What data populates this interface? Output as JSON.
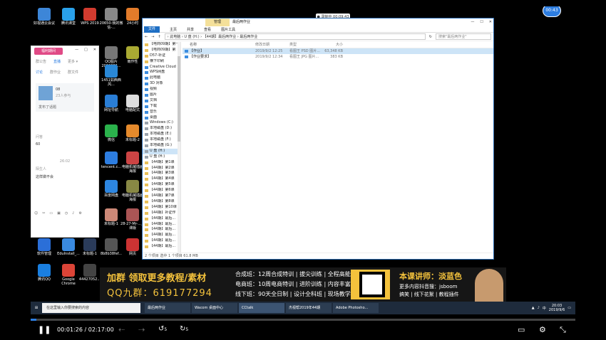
{
  "recording_badge": "● 录制中 00:09:43",
  "timer_badge": "00:43",
  "desktop_icons": [
    {
      "label": "好视通云会议",
      "color": "#3d86d8"
    },
    {
      "label": "腾讯课堂",
      "color": "#2aa1ea"
    },
    {
      "label": "WPS 2019",
      "color": "#d23b2f"
    },
    {
      "label": "20650-我的微信-...",
      "color": "#888"
    },
    {
      "label": "24小时",
      "color": "#e27b2a"
    },
    {
      "label": "QQ图片2019062...",
      "color": "#777"
    },
    {
      "label": "雨作性",
      "color": "#aa3"
    },
    {
      "label": "1451如西西风...",
      "color": "#2a88d6"
    },
    {
      "label": "网址导航",
      "color": "#2a7ed6"
    },
    {
      "label": "电脑配式",
      "color": "#ddd"
    },
    {
      "label": "微信",
      "color": "#2bb24c"
    },
    {
      "label": "未标题-2",
      "color": "#e58a2c"
    },
    {
      "label": "tencent.c...",
      "color": "#2d7de0"
    },
    {
      "label": "电脑机械插画海报",
      "color": "#c44"
    },
    {
      "label": "百度网盘",
      "color": "#2d86e0"
    },
    {
      "label": "电脑机械插画海报",
      "color": "#884"
    },
    {
      "label": "未标题-1",
      "color": "#c87"
    },
    {
      "label": "28-27-Mr-...上课版",
      "color": "#a55"
    },
    {
      "label": "软件管理",
      "color": "#2b6fd8"
    },
    {
      "label": "EduInstall_...",
      "color": "#3a8ae0"
    },
    {
      "label": "未标题-1",
      "color": "#2a3b5a"
    },
    {
      "label": "8b8b38fef...",
      "color": "#555"
    },
    {
      "label": "网页",
      "color": "#c33"
    },
    {
      "label": "腾讯QQ",
      "color": "#1a7fe0"
    },
    {
      "label": "Google Chrome",
      "color": "#db4437"
    },
    {
      "label": "44427052...",
      "color": "#444"
    }
  ],
  "explorer": {
    "context_tab": "管理",
    "title": "最后两作业",
    "window_controls": [
      "—",
      "☐",
      "✕"
    ],
    "ribbon_tabs": [
      "文件",
      "主页",
      "共享",
      "查看",
      "图片工具"
    ],
    "address": "› 此电脑 › U 盘 (H:) › 【44期】最后两作业 › 最后两作业",
    "search_placeholder": "搜索\"最后两作业\"",
    "nav_items": [
      {
        "label": "【电商09期】第一",
        "kind": "folder"
      },
      {
        "label": "【电商09期】第",
        "kind": "folder"
      },
      {
        "label": "D57-补证",
        "kind": "folder"
      },
      {
        "label": "横下印刷",
        "kind": "folder"
      },
      {
        "label": "Creative Cloud",
        "kind": "blue"
      },
      {
        "label": "WPS网盘",
        "kind": "blue"
      },
      {
        "label": "此电脑",
        "kind": "blue"
      },
      {
        "label": "3D 对象",
        "kind": "blue"
      },
      {
        "label": "视频",
        "kind": "blue"
      },
      {
        "label": "图片",
        "kind": "blue"
      },
      {
        "label": "文档",
        "kind": "blue"
      },
      {
        "label": "下载",
        "kind": "blue"
      },
      {
        "label": "音乐",
        "kind": "blue"
      },
      {
        "label": "桌面",
        "kind": "blue"
      },
      {
        "label": "Windows (C:)",
        "kind": "grey"
      },
      {
        "label": "本地磁盘 (D:)",
        "kind": "grey"
      },
      {
        "label": "本地磁盘 (E:)",
        "kind": "grey"
      },
      {
        "label": "本地磁盘 (F:)",
        "kind": "grey"
      },
      {
        "label": "本地磁盘 (G:)",
        "kind": "grey"
      },
      {
        "label": "U 盘 (H:)",
        "kind": "grey",
        "selected": true
      },
      {
        "label": "U 盘 (H:)",
        "kind": "grey"
      },
      {
        "label": "【44期】第1课",
        "kind": "folder"
      },
      {
        "label": "【44期】第2课",
        "kind": "folder"
      },
      {
        "label": "【44期】第3课",
        "kind": "folder"
      },
      {
        "label": "【44期】第4课",
        "kind": "folder"
      },
      {
        "label": "【44期】第5课",
        "kind": "folder"
      },
      {
        "label": "【44期】第6课",
        "kind": "folder"
      },
      {
        "label": "【44期】第7课",
        "kind": "folder"
      },
      {
        "label": "【44期】第8课",
        "kind": "folder"
      },
      {
        "label": "【44期】第10课",
        "kind": "folder"
      },
      {
        "label": "【44期】补证作",
        "kind": "folder"
      },
      {
        "label": "【44期】最后...",
        "kind": "folder"
      },
      {
        "label": "【44期】最后...",
        "kind": "folder"
      },
      {
        "label": "【44期】最后...",
        "kind": "folder"
      },
      {
        "label": "【44期】最后...",
        "kind": "folder"
      },
      {
        "label": "【44期】最后...",
        "kind": "folder"
      },
      {
        "label": "【44期】最后...",
        "kind": "folder"
      }
    ],
    "columns": [
      "名称",
      "修改日期",
      "类型",
      "大小"
    ],
    "files": [
      {
        "name": "【作业】",
        "date": "2019/9/2 12:25",
        "type": "看图王 PSD 图片...",
        "size": "63,348 KB",
        "selected": true
      },
      {
        "name": "【作业要求】",
        "date": "2019/9/2 12:34",
        "type": "看图王 JPG 图片...",
        "size": "383 KB",
        "selected": false
      }
    ],
    "status": "2 个项目  选中 1 个项目  61.8 MB"
  },
  "chat": {
    "avatar_label": "福利期间",
    "controls": [
      "—",
      "□",
      "✕"
    ],
    "top_tabs": [
      "群公告",
      "直播",
      "更多 ▾"
    ],
    "sub_tabs": [
      "讨论",
      "群作业",
      "群文件"
    ],
    "group_name": "08",
    "group_sub": "23人参与",
    "group_tag": "发布了话题",
    "msg1_label": "问答",
    "msg1": "60",
    "date_divider": "26:02",
    "msg2_label": "陌生人",
    "msg2": "这样做不会"
  },
  "banner": {
    "ad_line1": "加群 领取更多教程/素材",
    "ad_line2": "QQ九群：619177294",
    "course1": "合成班：12周合成特训 | 拔尖训练 | 全程高能",
    "course2": "电商班：10周电商特训 | 进阶训练 | 内容丰富",
    "course3": "线下班：90天全日制 | 设计全科班 | 现场教学",
    "teacher": "本课讲师：淡蓝色",
    "douyin": "更多内容抖音搜：jsboom",
    "slogan": "搞笑 | 线下花絮 | 教程插件"
  },
  "taskbar": {
    "search_placeholder": "在这里输入你要搜索的内容",
    "tasks": [
      {
        "label": "最后两作业",
        "active": false
      },
      {
        "label": "Wacom 桌面中心",
        "active": false
      },
      {
        "label": "CCtalk",
        "active": true
      },
      {
        "label": "杰视帮2019年44期",
        "active": false
      },
      {
        "label": "Adobe Photosho...",
        "active": false
      }
    ],
    "time": "20:03",
    "date": "2019/9/6"
  },
  "player": {
    "current_time": "00:01:26",
    "separator": "/",
    "total_time": "02:17:00",
    "progress_fraction": 0.0104,
    "rewind_label": "5",
    "forward_label": "5"
  }
}
